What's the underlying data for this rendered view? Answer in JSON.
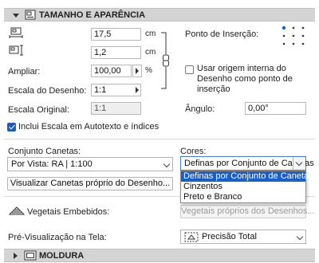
{
  "section_top": {
    "title": "TAMANHO E APARÊNCIA",
    "collapse_icon": "triangle-down-icon",
    "icon": "size-appearance-icon"
  },
  "size": {
    "width_value": "17,5",
    "width_unit": "cm",
    "height_value": "1,2",
    "height_unit": "cm",
    "amplify_label": "Ampliar:",
    "amplify_value": "100,00",
    "amplify_unit": "%",
    "scale_label": "Escala do Desenho:",
    "scale_value": "1:1",
    "original_label": "Escala Original:",
    "original_value": "1:1"
  },
  "insertion": {
    "label": "Ponto de Inserção:",
    "use_origin_label": "Usar origem interna do Desenho como ponto de inserção",
    "angle_label": "Ângulo:",
    "angle_value": "0,00°"
  },
  "include_scale": {
    "label": "Inclui Escala em Autotexto e índices",
    "checked": true
  },
  "pens": {
    "label": "Conjunto Canetas:",
    "value": "Por Vista: RA | 1:100",
    "view_button": "Visualizar Canetas próprio do Desenho..."
  },
  "colors": {
    "label": "Cores:",
    "value": "Definas por Conjunto de Canetas",
    "options": [
      "Definas por Conjunto de Canetas",
      "Cinzentos",
      "Preto e Branco"
    ],
    "selected_index": 0
  },
  "vegetation": {
    "label": "Vegetais Embebidos:",
    "button": "Vegetais próprios dos Desenhos..."
  },
  "preview": {
    "label": "Pré-Visualização na Tela:",
    "value": "Precisão Total"
  },
  "section_bottom": {
    "title": "MOLDURA",
    "collapse_icon": "triangle-right-icon",
    "icon": "frame-icon"
  },
  "colors_accent": {
    "selection": "#1a5fc9",
    "checkbox": "#1e5fb6"
  }
}
